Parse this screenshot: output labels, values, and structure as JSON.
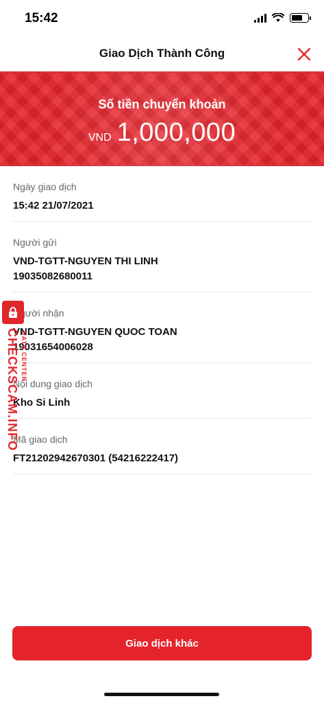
{
  "status_bar": {
    "time": "15:42",
    "icons": [
      "signal-icon",
      "wifi-icon",
      "battery-icon"
    ]
  },
  "header": {
    "title": "Giao Dịch Thành Công",
    "close_icon": "close-icon"
  },
  "banner": {
    "label": "Số tiền chuyển khoản",
    "currency": "VND",
    "amount": "1,000,000"
  },
  "details": [
    {
      "label": "Ngày giao dịch",
      "values": [
        "15:42 21/07/2021"
      ]
    },
    {
      "label": "Người gửi",
      "values": [
        "VND-TGTT-NGUYEN THI LINH",
        "19035082680011"
      ]
    },
    {
      "label": "Người nhận",
      "values": [
        "VND-TGTT-NGUYEN QUOC TOAN",
        "19031654006028"
      ]
    },
    {
      "label": "Nội dung giao dịch",
      "values": [
        "Kho Si Linh"
      ]
    },
    {
      "label": "Mã giao dịch",
      "values": [
        "FT21202942670301 (54216222417)"
      ]
    }
  ],
  "watermark": {
    "main": "CHECKSCAM.INFO",
    "sub": "DATA CENTER"
  },
  "actions": {
    "primary_label": "Giao dịch khác"
  },
  "colors": {
    "accent": "#e5232b",
    "divider": "#e6e6e6",
    "label": "#666666"
  }
}
